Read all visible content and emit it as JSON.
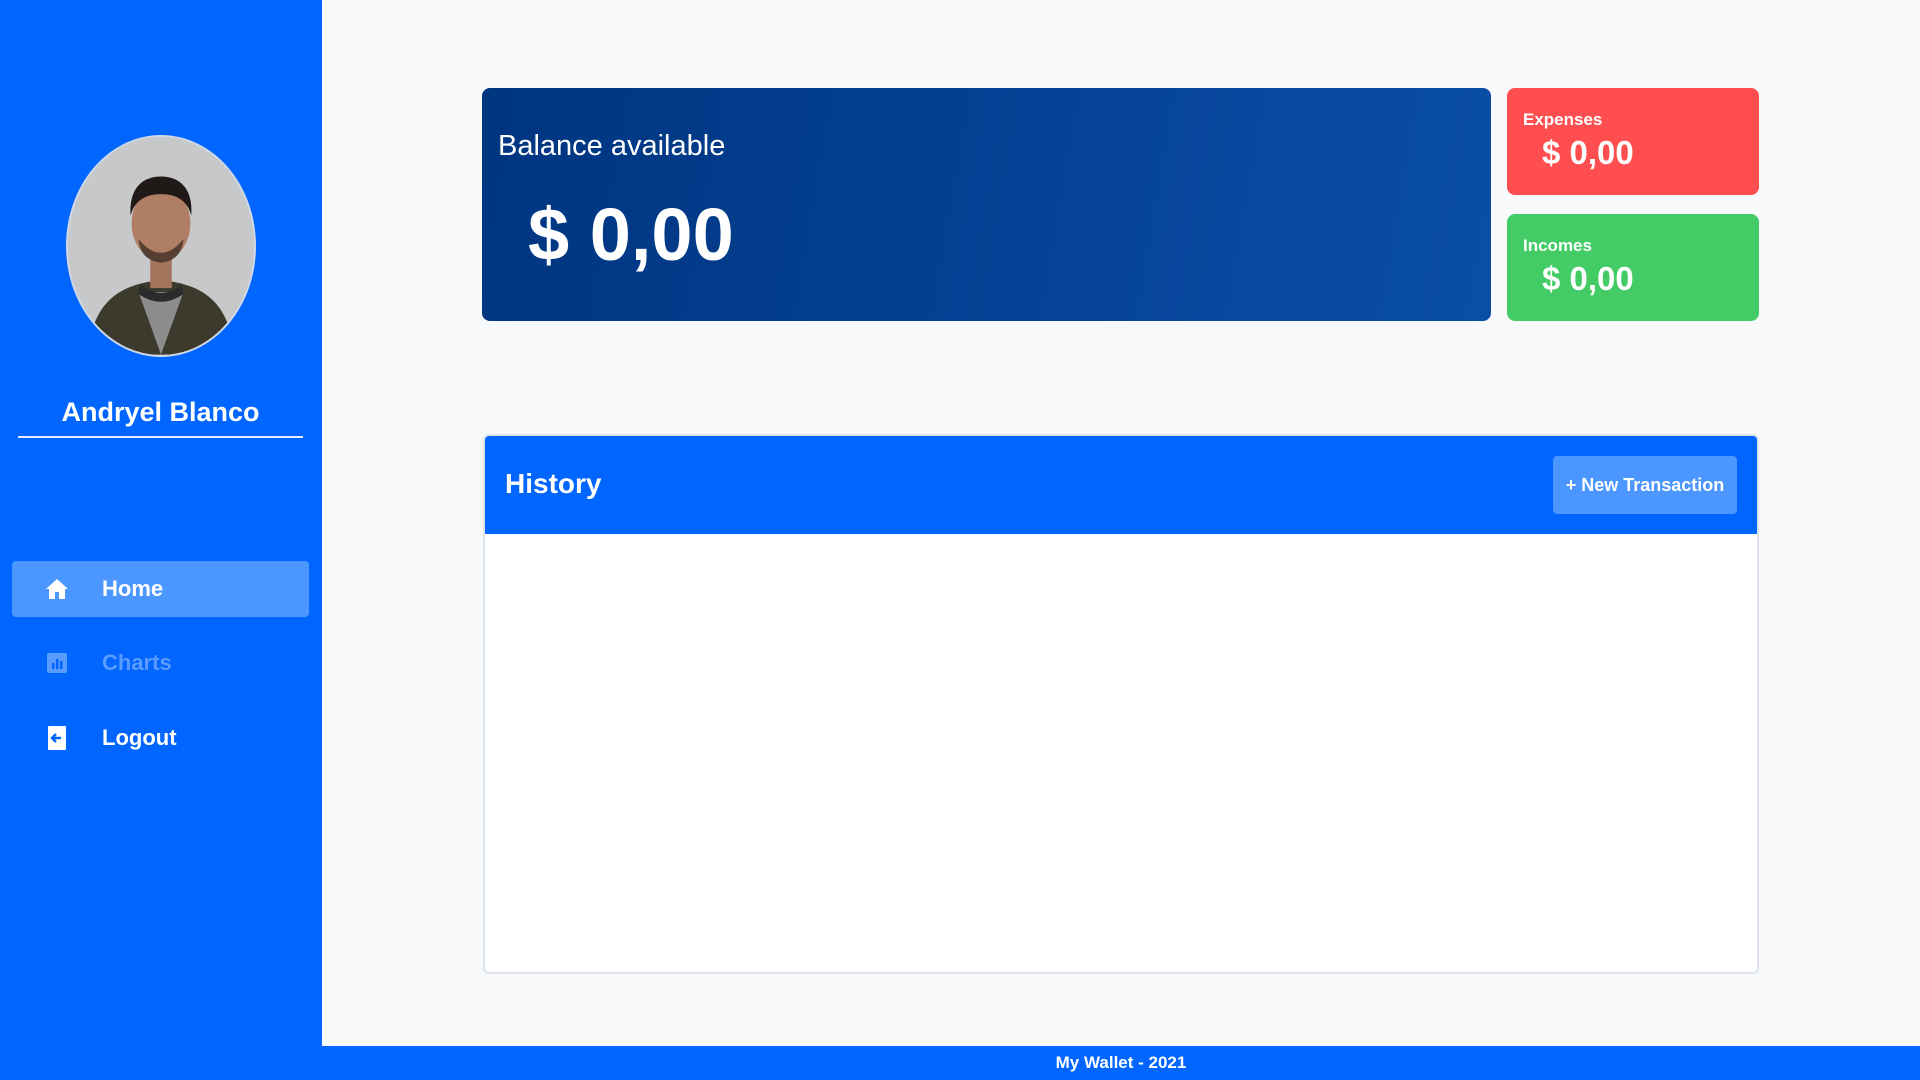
{
  "sidebar": {
    "user_name": "Andryel Blanco",
    "nav": [
      {
        "label": "Home",
        "icon": "home-icon",
        "active": true
      },
      {
        "label": "Charts",
        "icon": "bar-chart-icon",
        "active": false
      },
      {
        "label": "Logout",
        "icon": "logout-icon",
        "active": false
      }
    ]
  },
  "balance": {
    "label": "Balance available",
    "value": "$ 0,00"
  },
  "expenses": {
    "label": "Expenses",
    "value": "$ 0,00"
  },
  "incomes": {
    "label": "Incomes",
    "value": "$ 0,00"
  },
  "history": {
    "title": "History",
    "new_button_label": "+ New Transaction",
    "items": []
  },
  "footer": {
    "text": "My Wallet - 2021"
  },
  "colors": {
    "primary": "#0066ff",
    "primary_light": "#4c97ff",
    "balance_dark": "#003580",
    "expenses": "#ff4e4f",
    "incomes": "#43cc66"
  }
}
